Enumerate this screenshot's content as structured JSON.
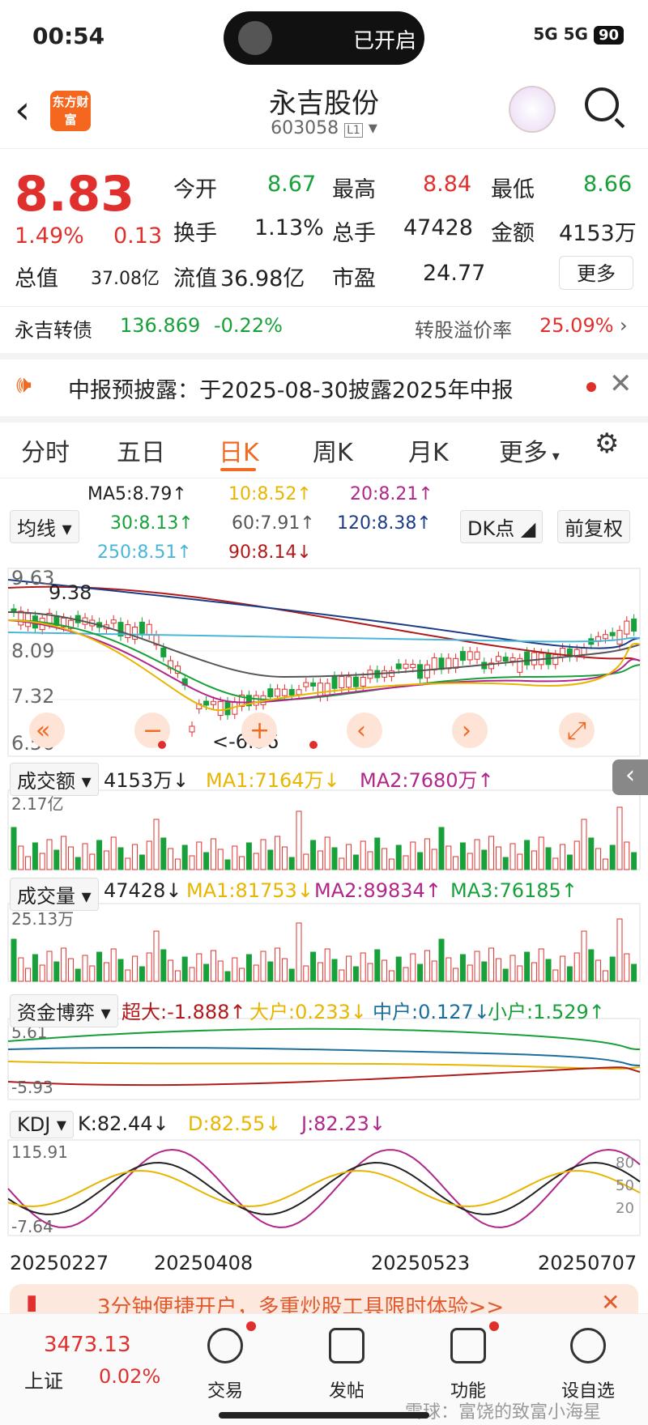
{
  "status": {
    "time": "00:54",
    "island_label": "已开启",
    "battery": "90",
    "signal": "5G 5G"
  },
  "header": {
    "title": "永吉股份",
    "code": "603058",
    "code_tag": "L1",
    "logo": "东方财富"
  },
  "quote": {
    "price": "8.83",
    "pct": "1.49%",
    "chg": "0.13",
    "open_l": "今开",
    "open_v": "8.67",
    "high_l": "最高",
    "high_v": "8.84",
    "low_l": "最低",
    "low_v": "8.66",
    "turn_l": "换手",
    "turn_v": "1.13%",
    "vol_l": "总手",
    "vol_v": "47428",
    "amt_l": "金额",
    "amt_v": "4153万",
    "mcap_l": "总值",
    "mcap_v": "37.08亿",
    "fcap_l": "流值",
    "fcap_v": "36.98亿",
    "pe_l": "市盈",
    "pe_v": "24.77",
    "more": "更多"
  },
  "bond": {
    "name": "永吉转债",
    "price": "136.869",
    "chg": "-0.22%",
    "prem_l": "转股溢价率",
    "prem_v": "25.09%"
  },
  "notice": {
    "text": "中报预披露：于2025-08-30披露2025年中报"
  },
  "tabs": [
    "分时",
    "五日",
    "日K",
    "周K",
    "月K",
    "更多"
  ],
  "ma": {
    "chip": "均线",
    "ma5": "MA5:8.79↑",
    "ma10": "10:8.52↑",
    "ma20": "20:8.21↑",
    "ma30": "30:8.13↑",
    "ma60": "60:7.91↑",
    "ma120": "120:8.38↑",
    "ma250": "250:8.51↑",
    "ma90": "90:8.14↓",
    "dk": "DK点",
    "fq": "前复权"
  },
  "kchart": {
    "y_top": "9.63",
    "y_mid1": "8.09",
    "y_mid2": "7.32",
    "y_low": "6.56",
    "label_high": "9.38",
    "label_low": "<-6.56"
  },
  "amount": {
    "chip": "成交额",
    "val": "4153万↓",
    "ma1": "MA1:7164万↓",
    "ma2": "MA2:7680万↑",
    "ymax": "2.17亿"
  },
  "volume": {
    "chip": "成交量",
    "val": "47428↓",
    "ma1": "MA1:81753↓",
    "ma2": "MA2:89834↑",
    "ma3": "MA3:76185↑",
    "ymax": "25.13万"
  },
  "capital": {
    "chip": "资金博弈",
    "a": "超大:-1.888↑",
    "b": "大户:0.233↓",
    "c": "中户:0.127↓",
    "d": "小户:1.529↑",
    "ymax": "5.61",
    "ymin": "-5.93"
  },
  "kdj": {
    "chip": "KDJ",
    "k": "K:82.44↓",
    "d": "D:82.55↓",
    "j": "J:82.23↓",
    "ymax": "115.91",
    "ymin": "-7.64",
    "l80": "80",
    "l50": "50",
    "l20": "20"
  },
  "dates": [
    "20250227",
    "20250408",
    "20250523",
    "20250707"
  ],
  "promo": {
    "text": "3分钟便捷开户，多重炒股工具限时体验>>"
  },
  "bottom": {
    "index": "3473.13",
    "index_name": "上证",
    "index_pct": "0.02%",
    "items": [
      "交易",
      "发帖",
      "功能",
      "设自选"
    ],
    "watermark": "雪球：富饶的致富小海星"
  }
}
